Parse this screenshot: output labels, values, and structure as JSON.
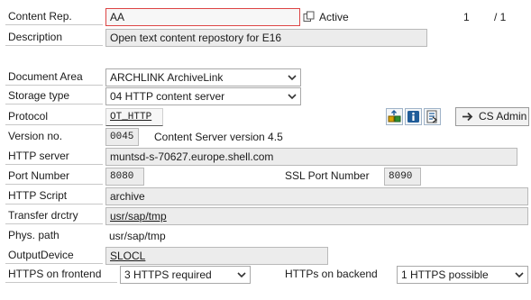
{
  "header": {
    "content_rep_label": "Content Rep.",
    "content_rep_value": "AA",
    "status": "Active",
    "page_current": "1",
    "page_total": "/ 1"
  },
  "description": {
    "label": "Description",
    "value": "Open text content repostory for E16"
  },
  "document_area": {
    "label": "Document Area",
    "value": "ARCHLINK ArchiveLink"
  },
  "storage_type": {
    "label": "Storage type",
    "value": "04 HTTP content server"
  },
  "protocol": {
    "label": "Protocol",
    "value": "OT_HTTP"
  },
  "cs_admin_button": {
    "label": "CS Admin"
  },
  "version": {
    "label": "Version no.",
    "value": "0045",
    "text": "Content Server version 4.5"
  },
  "http_server": {
    "label": "HTTP server",
    "value": "muntsd-s-70627.europe.shell.com"
  },
  "port_number": {
    "label": "Port Number",
    "value": "8080"
  },
  "ssl_port": {
    "label": "SSL Port Number",
    "value": "8090"
  },
  "http_script": {
    "label": "HTTP Script",
    "value": "archive"
  },
  "transfer_dir": {
    "label": "Transfer drctry",
    "value": "usr/sap/tmp"
  },
  "phys_path": {
    "label": "Phys. path",
    "value": "usr/sap/tmp"
  },
  "output_device": {
    "label": "OutputDevice",
    "value": "SLOCL"
  },
  "https_frontend": {
    "label": "HTTPS on frontend",
    "value": "3 HTTPS required"
  },
  "https_backend": {
    "label": "HTTPs on backend",
    "value": "1 HTTPS possible"
  },
  "colors": {
    "accent": "#1f5c99",
    "required_border": "#dd4444"
  },
  "icons": [
    "copy-icon",
    "dropdown-caret-icon",
    "transport-icon",
    "info-icon",
    "export-icon",
    "arrow-right-icon"
  ]
}
